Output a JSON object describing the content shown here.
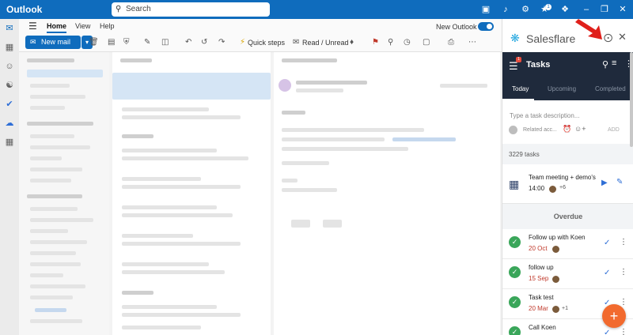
{
  "window": {
    "app_title": "Outlook"
  },
  "search": {
    "placeholder": "Search"
  },
  "ribbon": {
    "tabs": [
      "Home",
      "View",
      "Help"
    ],
    "new_outlook_label": "New Outlook",
    "new_mail_label": "New mail",
    "quick_steps_label": "Quick steps",
    "read_unread_label": "Read / Unread"
  },
  "salesflare": {
    "brand": "Salesflare",
    "menu_badge": "1",
    "title": "Tasks",
    "tabs": [
      "Today",
      "Upcoming",
      "Completed"
    ],
    "task_placeholder": "Type a task description...",
    "related_label": "Related acc...",
    "add_label": "ADD",
    "task_count": "3229 tasks",
    "meeting": {
      "title": "Team meeting + demo's",
      "time": "14:00",
      "extra": "+6"
    },
    "overdue_label": "Overdue",
    "tasks": [
      {
        "title": "Follow up with Koen",
        "due": "20 Oct",
        "extra": ""
      },
      {
        "title": "follow up",
        "due": "15 Sep",
        "extra": ""
      },
      {
        "title": "Task test",
        "due": "20 Mar",
        "extra": "+1"
      },
      {
        "title": "Call Koen",
        "due": "",
        "extra": ""
      }
    ],
    "fab_label": "+"
  },
  "colors": {
    "outlook_blue": "#0f6cbd",
    "salesflare_nav": "#1f2a3c",
    "fab_orange": "#f26a2e",
    "check_green": "#3aa65a",
    "overdue_red": "#c0392b"
  }
}
